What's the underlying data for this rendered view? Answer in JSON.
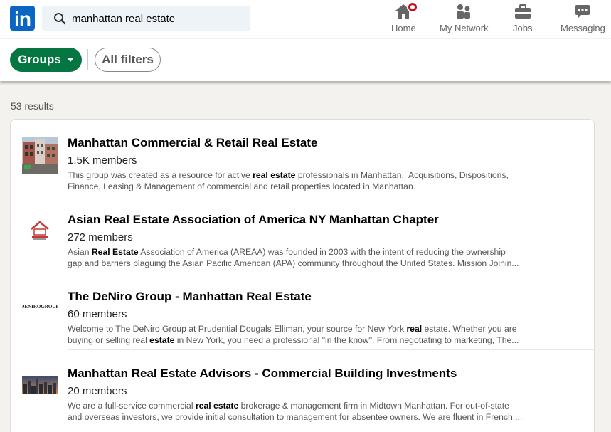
{
  "nav": {
    "logo_text": "in",
    "search_value": "manhattan real estate",
    "items": [
      {
        "label": "Home",
        "icon": "home-icon"
      },
      {
        "label": "My Network",
        "icon": "network-icon"
      },
      {
        "label": "Jobs",
        "icon": "briefcase-icon"
      },
      {
        "label": "Messaging",
        "icon": "messaging-icon"
      }
    ]
  },
  "filters": {
    "groups_label": "Groups",
    "all_filters_label": "All filters"
  },
  "results_count": "53 results",
  "results": [
    {
      "title": "Manhattan Commercial & Retail Real Estate",
      "members": "1.5K members",
      "desc1_a": "This group was created as a resource for active ",
      "desc1_b": "real estate",
      "desc1_c": " professionals in Manhattan.. Acquisitions, Dispositions,",
      "desc2": "Finance, Leasing & Management of commercial and retail properties located in Manhattan."
    },
    {
      "title": "Asian Real Estate Association of America NY Manhattan Chapter",
      "members": "272 members",
      "desc1_a": "Asian ",
      "desc1_b": "Real Estate",
      "desc1_c": " Association of America (AREAA) was founded in 2003 with the intent of reducing the ownership",
      "desc2": "gap and barriers plaguing the Asian Pacific American (APA) community throughout the United States. Mission Joinin..."
    },
    {
      "title": "The DeNiro Group - Manhattan Real Estate",
      "members": "60 members",
      "logo_text": "DENIROGROUP",
      "desc1_a": "Welcome to The DeNiro Group at Prudential Dougals Elliman, your source for New York ",
      "desc1_b": "real",
      "desc1_c": " estate. Whether you are",
      "desc2_a": "buying or selling real ",
      "desc2_b": "estate",
      "desc2_c": " in New York, you need a professional \"in the know\". From negotiating to marketing, The..."
    },
    {
      "title": "Manhattan Real Estate Advisors - Commercial Building Investments",
      "members": "20 members",
      "desc1_a": "We are a full-service commercial ",
      "desc1_b": "real estate",
      "desc1_c": " brokerage & management firm in Midtown Manhattan. For out-of-state",
      "desc2": "and overseas investors, we provide initial consultation to management for absentee owners. We are fluent in French,..."
    }
  ],
  "colors": {
    "brand_blue": "#0a66c2",
    "groups_green": "#057642",
    "notification_red": "#cc1016"
  }
}
